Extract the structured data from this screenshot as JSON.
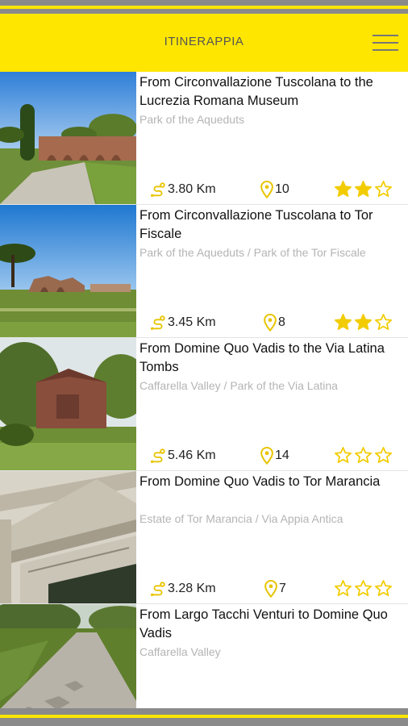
{
  "header": {
    "title": "ITINERAPPIA",
    "menu_icon": "hamburger-menu-icon"
  },
  "colors": {
    "accent": "#ffe600",
    "stat_icon": "#e8c400",
    "star": "#f2cc00"
  },
  "routes": [
    {
      "title": "From Circonvallazione Tuscolana to the Lucrezia Romana Museum",
      "subtitle": "Park of the Aqueduts",
      "distance": "3.80 Km",
      "stops": "10",
      "rating": 2,
      "image": "aqueduct-path-photo"
    },
    {
      "title": "From Circonvallazione Tuscolana to Tor Fiscale",
      "subtitle": "Park of the Aqueduts / Park of the Tor Fiscale",
      "distance": "3.45 Km",
      "stops": "8",
      "rating": 2,
      "image": "ruins-meadow-photo"
    },
    {
      "title": "From Domine Quo Vadis to the Via Latina Tombs",
      "subtitle": "Caffarella Valley / Park of the Via Latina",
      "distance": "5.46 Km",
      "stops": "14",
      "rating": 0,
      "image": "brick-tomb-photo"
    },
    {
      "title": "From Domine Quo Vadis to Tor Marancia",
      "subtitle": "Estate of Tor Marancia / Via Appia Antica",
      "distance": "3.28 Km",
      "stops": "7",
      "rating": 0,
      "image": "marble-portal-photo"
    },
    {
      "title": "From Largo Tacchi Venturi to Domine Quo Vadis",
      "subtitle": "Caffarella Valley",
      "distance": "",
      "stops": "",
      "rating": 0,
      "image": "roman-road-photo"
    }
  ]
}
